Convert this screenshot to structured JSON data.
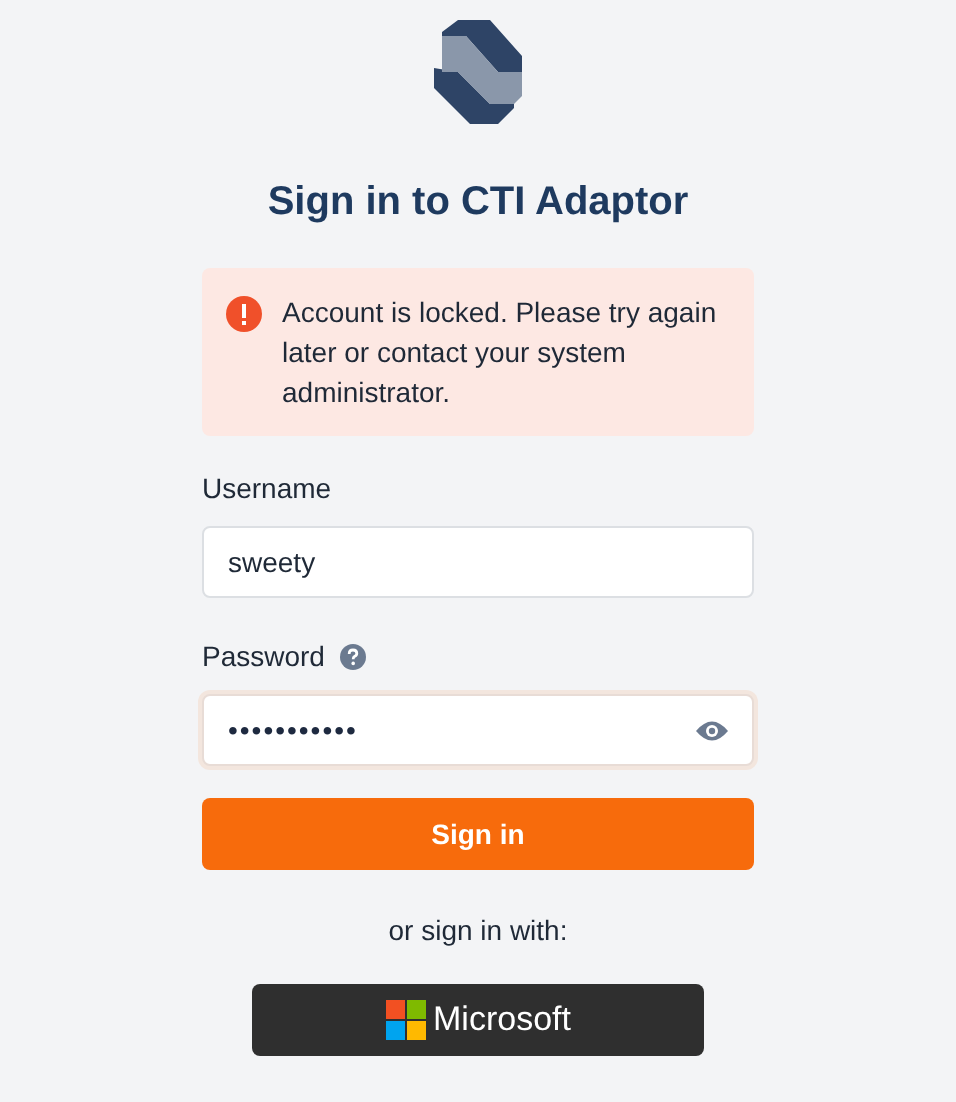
{
  "title": "Sign in to CTI Adaptor",
  "alert": {
    "message": "Account is locked. Please try again later or contact your system administrator."
  },
  "username": {
    "label": "Username",
    "value": "sweety"
  },
  "password": {
    "label": "Password",
    "masked_value": "•••••••••••",
    "focused": true
  },
  "sign_in_button": "Sign in",
  "alternative_text": "or sign in with:",
  "providers": [
    {
      "label": "Microsoft"
    }
  ]
}
